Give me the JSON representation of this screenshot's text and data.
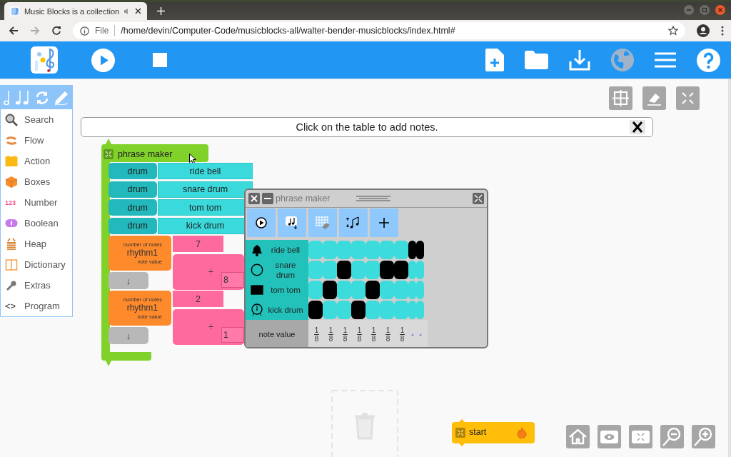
{
  "browser": {
    "tab_title": "Music Blocks is a collection",
    "url_scheme": "File",
    "url": "/home/devin/Computer-Code/musicblocks-all/walter-bender-musicblocks/index.html#"
  },
  "palette": {
    "items": [
      {
        "label": "Search",
        "kind": "search"
      },
      {
        "label": "Flow",
        "kind": "flow"
      },
      {
        "label": "Action",
        "kind": "action"
      },
      {
        "label": "Boxes",
        "kind": "boxes"
      },
      {
        "label": "Number",
        "kind": "number",
        "badge": "123"
      },
      {
        "label": "Boolean",
        "kind": "boolean"
      },
      {
        "label": "Heap",
        "kind": "heap"
      },
      {
        "label": "Dictionary",
        "kind": "dictionary"
      },
      {
        "label": "Extras",
        "kind": "extras"
      },
      {
        "label": "Program",
        "kind": "program",
        "badge": "<>"
      }
    ]
  },
  "message": "Click on the table to add notes.",
  "phrase_block": {
    "label": "phrase maker",
    "drums": [
      {
        "label": "drum",
        "value": "ride bell"
      },
      {
        "label": "drum",
        "value": "snare drum"
      },
      {
        "label": "drum",
        "value": "tom tom"
      },
      {
        "label": "drum",
        "value": "kick drum"
      }
    ],
    "rhythms": [
      {
        "top_label": "number of notes",
        "name": "rhythm1",
        "bottom_label": "note value",
        "count": "7",
        "operator": "÷",
        "divisor": "8",
        "arrow": "↓"
      },
      {
        "top_label": "number of notes",
        "name": "rhythm1",
        "bottom_label": "note value",
        "count": "2",
        "operator": "÷",
        "divisor": "1",
        "arrow": "↓"
      }
    ]
  },
  "widget": {
    "title": "phrase maker",
    "rows": [
      {
        "label": "ride bell",
        "kind": "bell",
        "cells": [
          false,
          false,
          false,
          false,
          false,
          false,
          false,
          true,
          true
        ]
      },
      {
        "label": "snare drum",
        "kind": "snare",
        "cells": [
          false,
          false,
          true,
          false,
          false,
          true,
          true,
          false,
          false
        ]
      },
      {
        "label": "tom tom",
        "kind": "tom",
        "cells": [
          false,
          true,
          false,
          false,
          true,
          false,
          false,
          false,
          false
        ]
      },
      {
        "label": "kick drum",
        "kind": "kick",
        "cells": [
          true,
          false,
          false,
          true,
          false,
          false,
          false,
          false,
          false
        ]
      }
    ],
    "note_label": "note value",
    "note_values": [
      {
        "numerator": "1",
        "denominator": "8"
      },
      {
        "numerator": "1",
        "denominator": "8"
      },
      {
        "numerator": "1",
        "denominator": "8"
      },
      {
        "numerator": "1",
        "denominator": "8"
      },
      {
        "numerator": "1",
        "denominator": "8"
      },
      {
        "numerator": "1",
        "denominator": "8"
      },
      {
        "numerator": "1",
        "denominator": "8"
      }
    ]
  },
  "start_block": {
    "label": "start"
  }
}
